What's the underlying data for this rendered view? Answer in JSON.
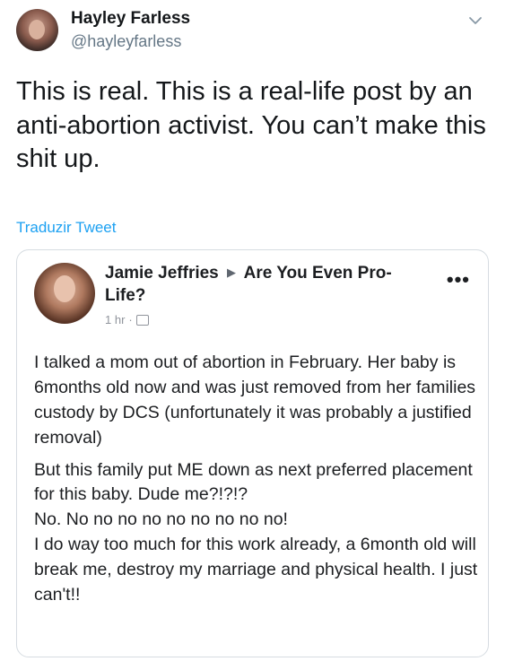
{
  "tweet": {
    "display_name": "Hayley Farless",
    "handle": "@hayleyfarless",
    "text": "This is real. This is a real-life post by an anti-abortion activist. You can’t make this shit up.",
    "translate_label": "Traduzir Tweet",
    "accent_color": "#1da1f2"
  },
  "embedded_post": {
    "author": "Jamie Jeffries",
    "group": "Are You Even Pro-Life?",
    "time": "1 hr",
    "paragraphs": [
      "I talked a mom out of abortion in February. Her baby is 6months old now and was just removed from her families custody by DCS (unfortunately it was probably a justified removal)",
      "But this family put ME down as next preferred placement for this baby. Dude me?!?!?",
      "No. No no no no no no no no no!",
      "I do way too much for this work already, a 6month old will break me, destroy my marriage and physical health. I just can't!!"
    ]
  },
  "icons": {
    "menu": "chevron-down-icon",
    "more": "more-options-icon",
    "privacy": "globe-icon",
    "separator": "triangle-right-icon"
  }
}
